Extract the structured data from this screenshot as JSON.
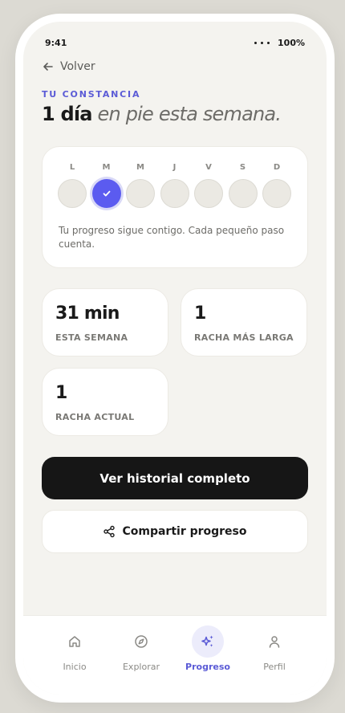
{
  "status": {
    "time": "9:41",
    "battery": "100%"
  },
  "header": {
    "back_label": "Volver",
    "eyebrow": "TU CONSTANCIA",
    "headline_strong": "1 día",
    "headline_soft": "en pie esta semana."
  },
  "week": {
    "days": [
      {
        "label": "L",
        "done": false
      },
      {
        "label": "M",
        "done": true
      },
      {
        "label": "M",
        "done": false
      },
      {
        "label": "J",
        "done": false
      },
      {
        "label": "V",
        "done": false
      },
      {
        "label": "S",
        "done": false
      },
      {
        "label": "D",
        "done": false
      }
    ],
    "message": "Tu progreso sigue contigo. Cada pequeño paso cuenta."
  },
  "stats": [
    {
      "value": "31 min",
      "label": "ESTA SEMANA"
    },
    {
      "value": "1",
      "label": "RACHA MÁS LARGA"
    },
    {
      "value": "1",
      "label": "RACHA ACTUAL"
    }
  ],
  "actions": {
    "primary": "Ver historial completo",
    "secondary": "Compartir progreso"
  },
  "tabs": [
    {
      "label": "Inicio",
      "icon": "home-icon",
      "active": false
    },
    {
      "label": "Explorar",
      "icon": "compass-icon",
      "active": false
    },
    {
      "label": "Progreso",
      "icon": "sparkles-icon",
      "active": true
    },
    {
      "label": "Perfil",
      "icon": "user-icon",
      "active": false
    }
  ],
  "colors": {
    "accent": "#5b5bf0",
    "accent_text": "#5b5bd6",
    "primary_button": "#161616",
    "background": "#f4f3ef"
  }
}
